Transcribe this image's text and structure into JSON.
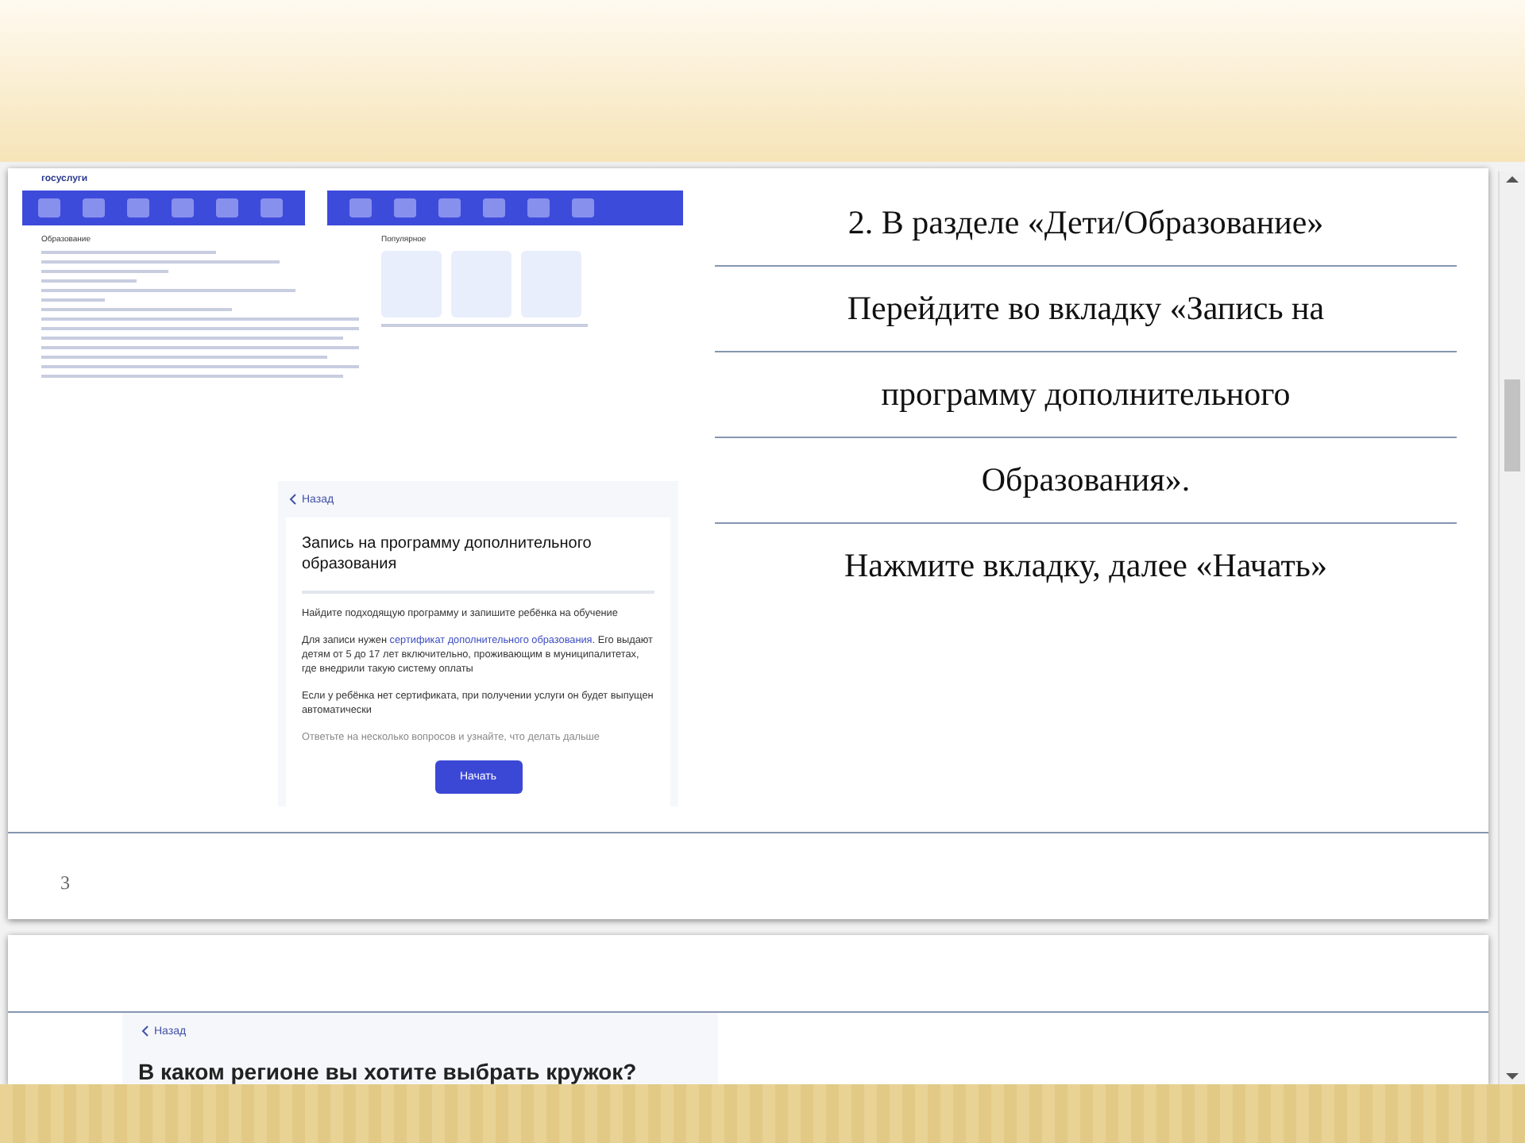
{
  "slide_page": {
    "screenshot_top": {
      "logo": "госуслуги",
      "section_heading": "Образование",
      "popular_heading": "Популярное"
    },
    "service_card": {
      "back_link": "Назад",
      "title": "Запись на программу дополнительного образования",
      "intro": "Найдите подходящую программу и запишите ребёнка на обучение",
      "requirement": {
        "before": "Для записи нужен ",
        "link": "сертификат дополнительного образования",
        "after": ". Его выдают детям от 5 до 17 лет включительно, проживающим в муниципалитетах, где внедрили такую систему оплаты"
      },
      "auto_note": "Если у ребёнка нет сертификата, при получении услуги он будет выпущен автоматически",
      "hint": "Ответьте на несколько вопросов и узнайте, что делать дальше",
      "start_button": "Начать"
    },
    "instruction_lines": [
      "2. В разделе «Дети/Образование»",
      "Перейдите во вкладку «Запись на",
      "программу дополнительного",
      "Образования».",
      "Нажмите вкладку, далее «Начать»"
    ],
    "page_number": "3"
  },
  "next_page": {
    "back_link": "Назад",
    "question": "В каком регионе вы хотите выбрать кружок?"
  }
}
